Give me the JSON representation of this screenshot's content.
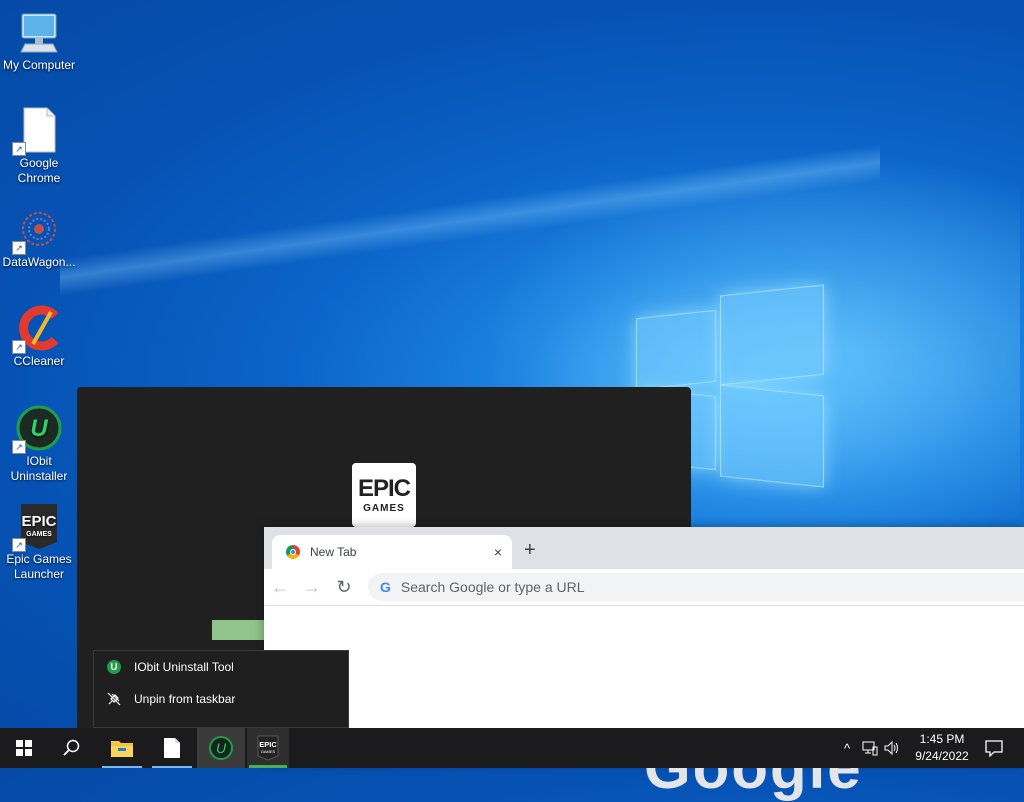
{
  "desktop": {
    "icons": [
      {
        "label": "My Computer",
        "icon": "computer-icon"
      },
      {
        "label": "Google Chrome",
        "icon": "blank-file-icon",
        "shortcut": true
      },
      {
        "label": "DataWagon...",
        "icon": "datawagon-icon",
        "shortcut": true
      },
      {
        "label": "CCleaner",
        "icon": "ccleaner-icon",
        "shortcut": true
      },
      {
        "label": "IObit Uninstaller",
        "icon": "iobit-icon",
        "shortcut": true
      },
      {
        "label": "Epic Games Launcher",
        "icon": "epic-games-icon",
        "shortcut": true
      }
    ]
  },
  "epic_splash": {
    "logo_top": "EPIC",
    "logo_bottom": "GAMES"
  },
  "chrome": {
    "tab_title": "New Tab",
    "tab_close": "×",
    "new_tab": "+",
    "back": "←",
    "forward": "→",
    "reload": "↻",
    "omnibox_g": "G",
    "omnibox_placeholder": "Search Google or type a URL",
    "google_partial": "Google"
  },
  "jumplist": {
    "items": [
      {
        "label": "IObit Uninstall Tool",
        "icon": "iobit-icon"
      },
      {
        "label": "Unpin from taskbar",
        "icon": "unpin-icon"
      }
    ]
  },
  "taskbar": {
    "apps": [
      "start-icon",
      "search-icon",
      "file-explorer-icon",
      "file-icon",
      "iobit-icon",
      "epic-games-icon"
    ],
    "epic_label_top": "EPIC",
    "epic_label_bottom": "GAMES",
    "iobit_glyph": "U",
    "tray_chevron": "^",
    "time": "1:45 PM",
    "date": "9/24/2022"
  }
}
